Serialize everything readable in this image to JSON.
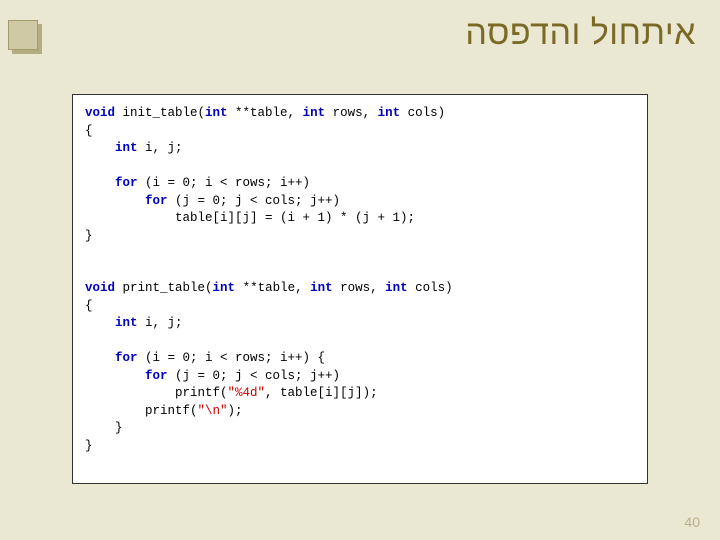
{
  "slide": {
    "title": "איתחול והדפסה",
    "page_number": "40"
  },
  "code": {
    "kw_void1": "void",
    "fn_init": " init_table(",
    "kw_int1": "int",
    "p_init1": " **table, ",
    "kw_int2": "int",
    "p_init2": " rows, ",
    "kw_int3": "int",
    "p_init3": " cols)",
    "lbrace1": "{",
    "tab1": "    ",
    "kw_int4": "int",
    "decl1": " i, j;",
    "blank": "",
    "kw_for1": "for",
    "for1a": " (i = 0; i < rows; i++)",
    "tab2": "        ",
    "kw_for2": "for",
    "for2a": " (j = 0; j < cols; j++)",
    "tab3": "            ",
    "assign": "table[i][j] = (i + 1) * (j + 1);",
    "rbrace1": "}",
    "kw_void2": "void",
    "fn_print": " print_table(",
    "kw_int5": "int",
    "p_print1": " **table, ",
    "kw_int6": "int",
    "p_print2": " rows, ",
    "kw_int7": "int",
    "p_print3": " cols)",
    "lbrace2": "{",
    "kw_int8": "int",
    "decl2": " i, j;",
    "kw_for3": "for",
    "for3a": " (i = 0; i < rows; i++) {",
    "kw_for4": "for",
    "for4a": " (j = 0; j < cols; j++)",
    "printf1a": "printf(",
    "str1": "\"%4d\"",
    "printf1b": ", table[i][j]);",
    "printf2a": "printf(",
    "str2": "\"\\n\"",
    "printf2b": ");",
    "rbrace_inner": "}",
    "rbrace2": "}"
  }
}
